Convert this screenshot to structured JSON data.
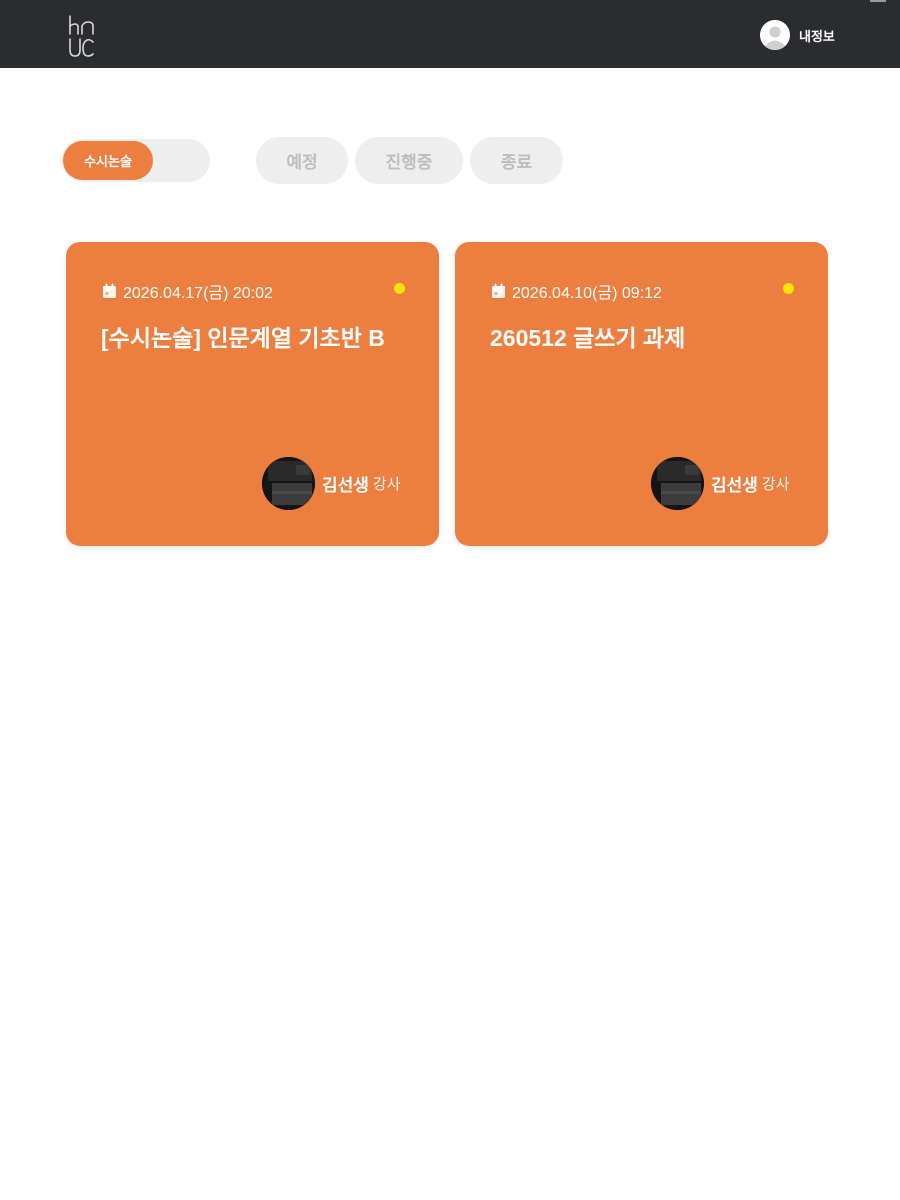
{
  "header": {
    "profile_label": "내정보",
    "logo_icon": "hnuc-logo-icon",
    "avatar_icon": "user-avatar-icon"
  },
  "filters": {
    "category_toggle_label": "수시논술",
    "status_tabs": [
      "예정",
      "진행중",
      "종료"
    ]
  },
  "cards": [
    {
      "date": "2026.04.17(금) 20:02",
      "title": "[수시논술] 인문계열 기초반 B",
      "instructor_name": "김선생",
      "instructor_role": "강사",
      "status_color": "#ffe100"
    },
    {
      "date": "2026.04.10(금) 09:12",
      "title": "260512 글쓰기 과제",
      "instructor_name": "김선생",
      "instructor_role": "강사",
      "status_color": "#ffe100"
    }
  ],
  "colors": {
    "header_bg": "#2b2c2f",
    "accent": "#ec7f3f",
    "inactive_pill_bg": "#eeeeee",
    "inactive_pill_text": "#bdbdbd",
    "status_dot": "#ffe100"
  }
}
